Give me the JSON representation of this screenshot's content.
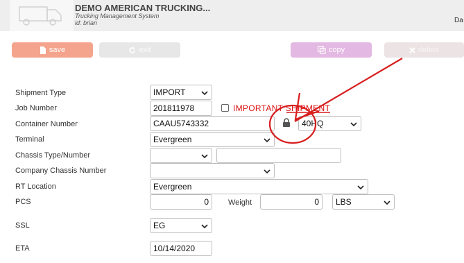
{
  "header": {
    "company": "DEMO AMERICAN TRUCKING...",
    "subtitle": "Trucking Management System",
    "user_id": "id: brian",
    "right_text": "Da"
  },
  "toolbar": {
    "save_label": "save",
    "exit_label": "exit",
    "copy_label": "copy",
    "delete_label": "delete"
  },
  "form": {
    "shipment_type": {
      "label": "Shipment Type",
      "value": "IMPORT"
    },
    "job_number": {
      "label": "Job Number",
      "value": "201811978"
    },
    "important_shipment": {
      "label": "IMPORTANT SHIPMENT",
      "checked": false
    },
    "container_number": {
      "label": "Container Number",
      "value": "CAAU5743332",
      "size": "40HQ"
    },
    "terminal": {
      "label": "Terminal",
      "value": "Evergreen"
    },
    "chassis_type_number": {
      "label": "Chassis Type/Number",
      "type_value": "",
      "number_value": ""
    },
    "company_chassis_number": {
      "label": "Company Chassis Number",
      "value": ""
    },
    "rt_location": {
      "label": "RT Location",
      "value": "Evergreen"
    },
    "pcs": {
      "label": "PCS",
      "value": "0"
    },
    "weight": {
      "label": "Weight",
      "value": "0",
      "unit": "LBS"
    },
    "ssl": {
      "label": "SSL",
      "value": "EG"
    },
    "eta": {
      "label": "ETA",
      "value": "10/14/2020"
    }
  },
  "icons": {
    "truck": "truck-logo-icon",
    "save": "file-icon",
    "exit": "refresh-icon",
    "copy": "copy-icon",
    "delete": "x-icon",
    "lock": "lock-icon"
  },
  "colors": {
    "save": "#f4a48c",
    "copy": "#e3b8e2",
    "important": "#dd1111",
    "annotation": "#d81d1d"
  }
}
